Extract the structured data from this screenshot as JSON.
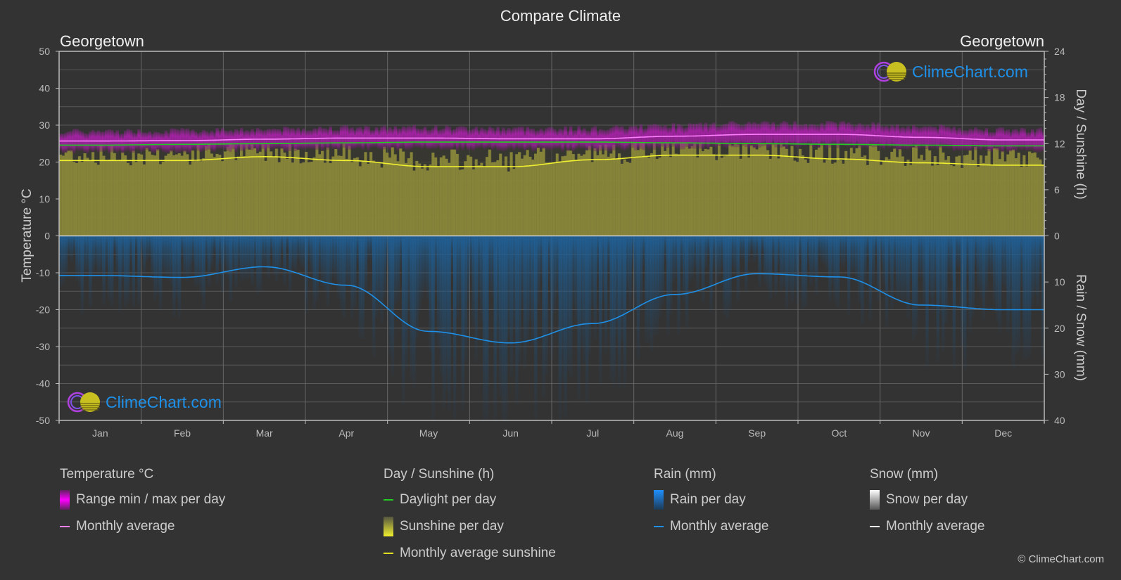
{
  "title": "Compare Climate",
  "location_left": "Georgetown",
  "location_right": "Georgetown",
  "brand_text": "ClimeChart.com",
  "copyright": "© ClimeChart.com",
  "colors": {
    "background": "#333333",
    "temp_range": "#d000d0",
    "temp_avg": "#ff80ff",
    "daylight": "#22cc22",
    "sunshine_fill": "#8c8a3a",
    "sunshine_avg": "#f0f030",
    "rain_fill": "#1e5f94",
    "rain_avg": "#1e90e8",
    "snow_avg": "#ffffff",
    "grid": "#5a5a5a",
    "axis": "#bbbbbb"
  },
  "legend": {
    "temperature": {
      "title": "Temperature °C",
      "items": [
        {
          "label": "Range min / max per day",
          "kind": "box-magenta"
        },
        {
          "label": "Monthly average",
          "kind": "line-pink"
        }
      ]
    },
    "sunshine": {
      "title": "Day / Sunshine (h)",
      "items": [
        {
          "label": "Daylight per day",
          "kind": "line-green"
        },
        {
          "label": "Sunshine per day",
          "kind": "box-yellow"
        },
        {
          "label": "Monthly average sunshine",
          "kind": "line-yellow"
        }
      ]
    },
    "rain": {
      "title": "Rain (mm)",
      "items": [
        {
          "label": "Rain per day",
          "kind": "box-blue"
        },
        {
          "label": "Monthly average",
          "kind": "line-blue"
        }
      ]
    },
    "snow": {
      "title": "Snow (mm)",
      "items": [
        {
          "label": "Snow per day",
          "kind": "box-white"
        },
        {
          "label": "Monthly average",
          "kind": "line-white"
        }
      ]
    }
  },
  "chart_data": {
    "type": "line",
    "title": "Compare Climate",
    "categories": [
      "Jan",
      "Feb",
      "Mar",
      "Apr",
      "May",
      "Jun",
      "Jul",
      "Aug",
      "Sep",
      "Oct",
      "Nov",
      "Dec"
    ],
    "axes": {
      "left": {
        "label": "Temperature °C",
        "range": [
          -50,
          50
        ],
        "ticks": [
          50,
          40,
          30,
          20,
          10,
          0,
          -10,
          -20,
          -30,
          -40,
          -50
        ]
      },
      "right_top": {
        "label": "Day / Sunshine (h)",
        "range": [
          0,
          24
        ],
        "ticks": [
          24,
          18,
          12,
          6,
          0
        ]
      },
      "right_bottom": {
        "label": "Rain / Snow (mm)",
        "range": [
          0,
          40
        ],
        "ticks": [
          0,
          10,
          20,
          30,
          40
        ]
      }
    },
    "grid": true,
    "series": [
      {
        "name": "Temperature monthly average",
        "axis": "left",
        "unit": "°C",
        "values": [
          25.7,
          25.8,
          26.2,
          26.5,
          26.5,
          26.3,
          26.3,
          27.0,
          27.5,
          27.5,
          26.7,
          26.0
        ]
      },
      {
        "name": "Temperature daily max (approx)",
        "axis": "left",
        "unit": "°C",
        "values": [
          28.0,
          28.2,
          28.6,
          29.0,
          29.0,
          28.8,
          28.8,
          29.6,
          30.2,
          30.2,
          29.3,
          28.4
        ]
      },
      {
        "name": "Temperature daily min (approx)",
        "axis": "left",
        "unit": "°C",
        "values": [
          23.3,
          23.4,
          23.8,
          24.1,
          24.1,
          23.9,
          23.8,
          24.3,
          24.6,
          24.6,
          24.1,
          23.6
        ]
      },
      {
        "name": "Daylight per day",
        "axis": "right_top",
        "unit": "h",
        "values": [
          11.8,
          11.9,
          12.0,
          12.1,
          12.2,
          12.2,
          12.2,
          12.1,
          12.0,
          11.9,
          11.8,
          11.7
        ]
      },
      {
        "name": "Monthly average sunshine",
        "axis": "right_top",
        "unit": "h",
        "values": [
          9.8,
          9.8,
          10.3,
          9.8,
          9.0,
          9.0,
          9.9,
          10.5,
          10.5,
          10.0,
          9.5,
          9.2
        ]
      },
      {
        "name": "Rain monthly average",
        "axis": "right_bottom",
        "unit": "mm",
        "values": [
          8.6,
          9.0,
          6.7,
          10.7,
          20.7,
          23.2,
          19.0,
          12.7,
          8.2,
          8.9,
          15.0,
          16.0
        ]
      },
      {
        "name": "Snow monthly average",
        "axis": "right_bottom",
        "unit": "mm",
        "values": [
          0,
          0,
          0,
          0,
          0,
          0,
          0,
          0,
          0,
          0,
          0,
          0
        ]
      }
    ]
  }
}
